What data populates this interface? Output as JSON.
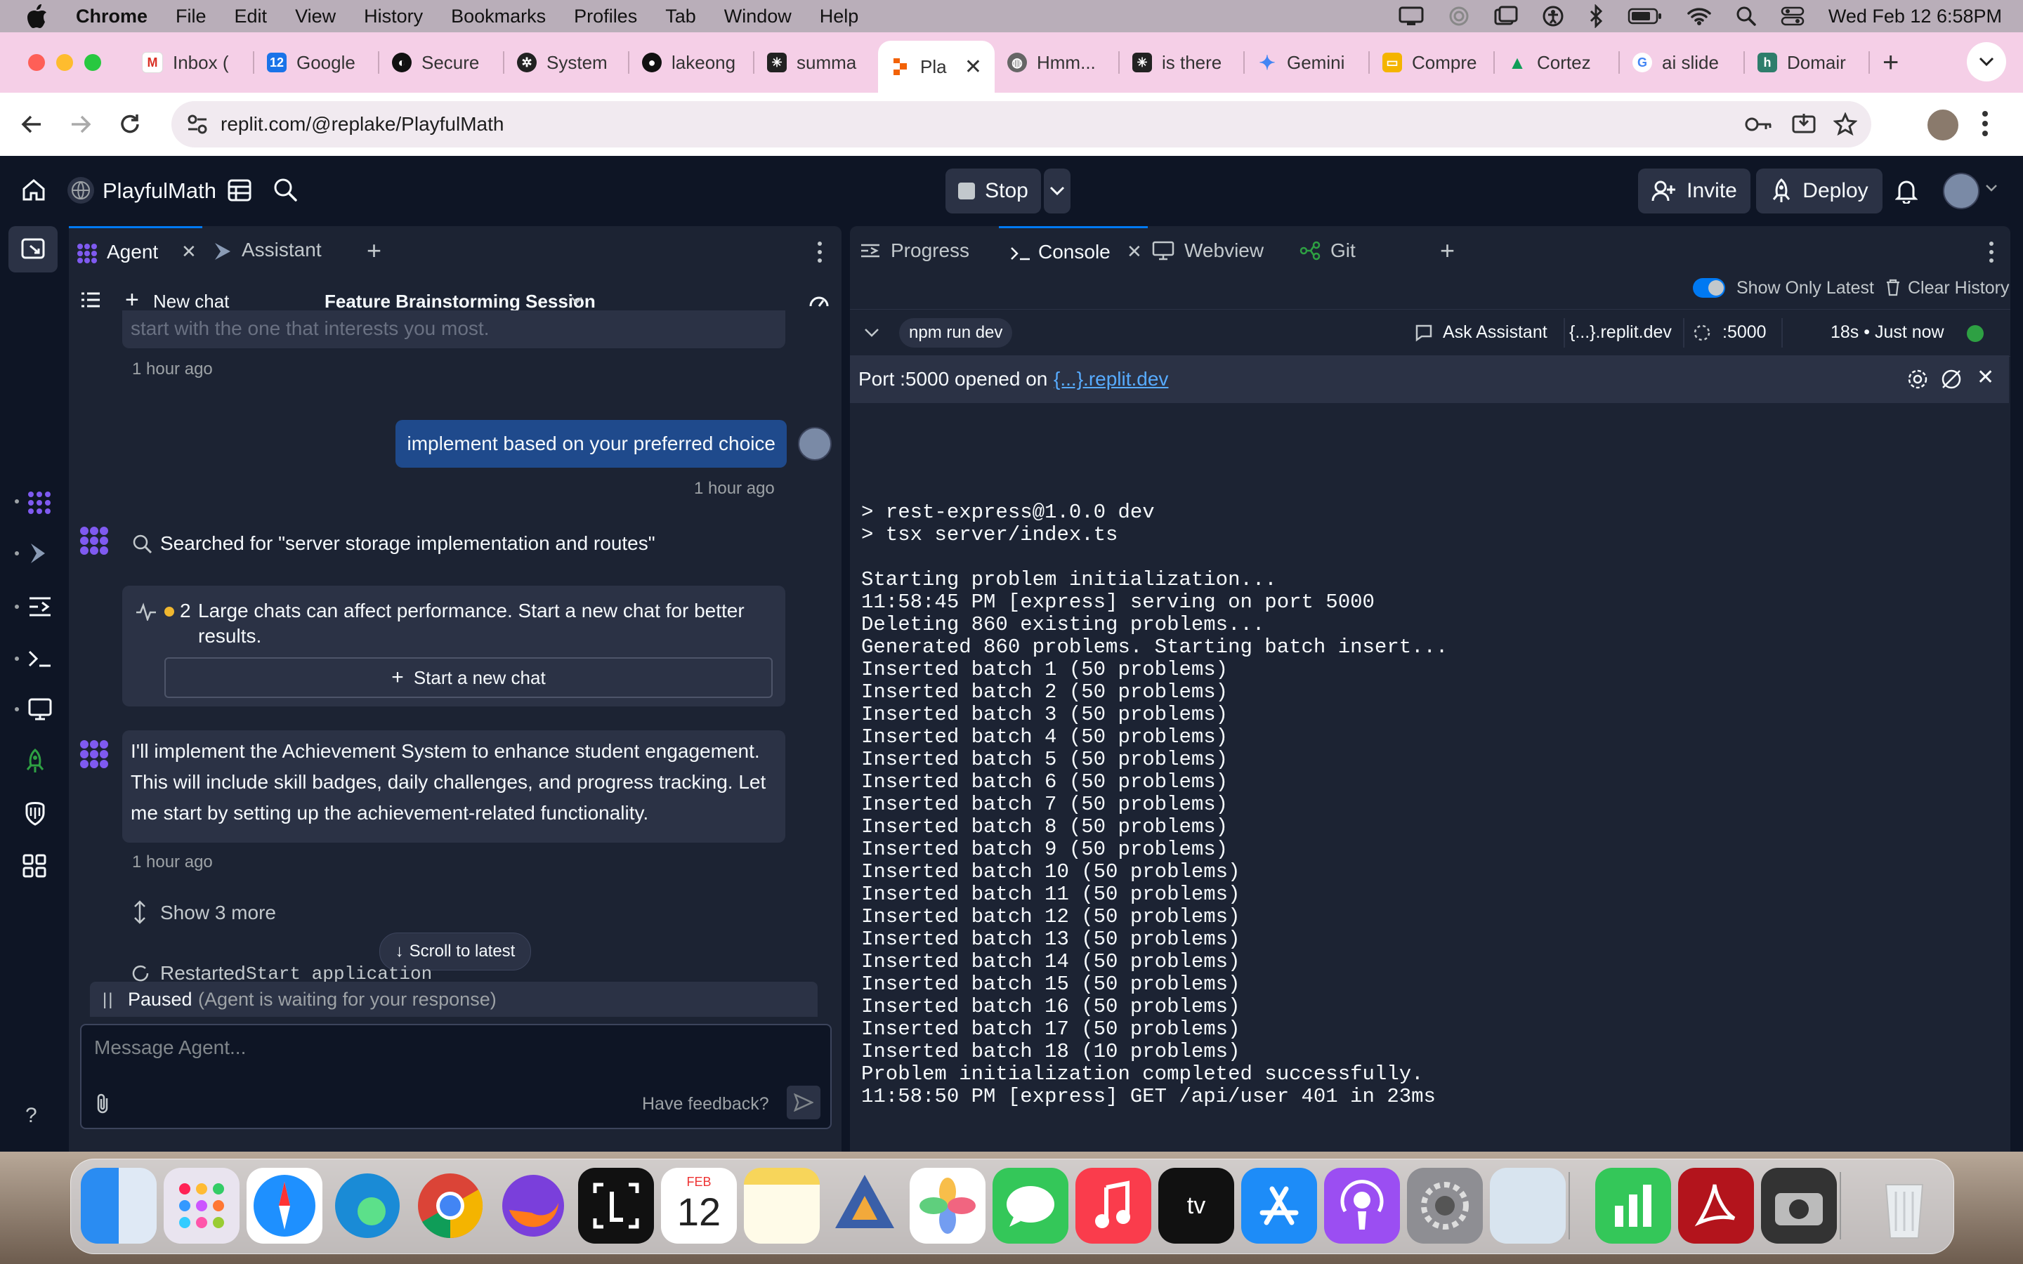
{
  "menubar": {
    "app_name": "Chrome",
    "menus": [
      "File",
      "Edit",
      "View",
      "History",
      "Bookmarks",
      "Profiles",
      "Tab",
      "Window",
      "Help"
    ],
    "clock": "Wed Feb 12  6:58PM"
  },
  "browser": {
    "tabs": [
      {
        "title": "Inbox (",
        "icon": "gmail-icon"
      },
      {
        "title": "Google",
        "icon": "google-calendar-icon"
      },
      {
        "title": "Secure",
        "icon": "secure-icon"
      },
      {
        "title": "System",
        "icon": "openai-icon"
      },
      {
        "title": "lakeong",
        "icon": "github-icon"
      },
      {
        "title": "summa",
        "icon": "perplexity-icon"
      },
      {
        "title": "Pla",
        "icon": "replit-icon",
        "active": true
      },
      {
        "title": "Hmm...",
        "icon": "globe-icon"
      },
      {
        "title": "is there",
        "icon": "perplexity-icon"
      },
      {
        "title": "Gemini",
        "icon": "gemini-icon"
      },
      {
        "title": "Compre",
        "icon": "slides-icon"
      },
      {
        "title": "Cortez",
        "icon": "drive-icon"
      },
      {
        "title": "ai slide",
        "icon": "google-icon"
      },
      {
        "title": "Domair",
        "icon": "hostinger-icon"
      }
    ],
    "url": "replit.com/@replake/PlayfulMath"
  },
  "replit": {
    "project_name": "PlayfulMath",
    "stop_label": "Stop",
    "invite_label": "Invite",
    "deploy_label": "Deploy",
    "left_tabs": {
      "agent": "Agent",
      "assistant": "Assistant"
    },
    "new_chat_label": "New chat",
    "session_title": "Feature Brainstorming Session",
    "faded_text": "start with the one that interests you most.",
    "time_1": "1 hour ago",
    "user_message": "implement based on your preferred choice",
    "time_2": "1 hour ago",
    "search_text": "Searched for \"server storage implementation and routes\"",
    "warning_count": "2",
    "warning_text_1": "Large chats can affect performance. Start a new chat for better",
    "warning_text_2": "results.",
    "start_new_chat_label": "Start a new chat",
    "agent_message_1": "I'll implement the Achievement System to enhance student engagement.",
    "agent_message_2": "This will include skill badges, daily challenges, and progress tracking. Let",
    "agent_message_3": "me start by setting up the achievement-related functionality.",
    "time_3": "1 hour ago",
    "show_more_label": "Show 3 more",
    "scroll_latest_label": "Scroll to latest",
    "restarted_label": "Restarted",
    "restarted_code": "Start application",
    "paused_label": "Paused",
    "paused_detail": "(Agent is waiting for your response)",
    "message_placeholder": "Message Agent...",
    "feedback_label": "Have feedback?",
    "right_tabs": {
      "progress": "Progress",
      "console": "Console",
      "webview": "Webview",
      "git": "Git"
    },
    "show_only_latest_label": "Show Only Latest",
    "show_only_latest_on": true,
    "clear_history_label": "Clear History",
    "command": "npm run dev",
    "ask_assistant_label": "Ask Assistant",
    "domain_label": "{...}.replit.dev",
    "port_label": ":5000",
    "run_time": "18s • Just now",
    "port_notice_prefix": "Port :5000 opened on ",
    "port_notice_link": "{...}.replit.dev",
    "console_lines": [
      "> rest-express@1.0.0 dev",
      "> tsx server/index.ts",
      "",
      "Starting problem initialization...",
      "11:58:45 PM [express] serving on port 5000",
      "Deleting 860 existing problems...",
      "Generated 860 problems. Starting batch insert...",
      "Inserted batch 1 (50 problems)",
      "Inserted batch 2 (50 problems)",
      "Inserted batch 3 (50 problems)",
      "Inserted batch 4 (50 problems)",
      "Inserted batch 5 (50 problems)",
      "Inserted batch 6 (50 problems)",
      "Inserted batch 7 (50 problems)",
      "Inserted batch 8 (50 problems)",
      "Inserted batch 9 (50 problems)",
      "Inserted batch 10 (50 problems)",
      "Inserted batch 11 (50 problems)",
      "Inserted batch 12 (50 problems)",
      "Inserted batch 13 (50 problems)",
      "Inserted batch 14 (50 problems)",
      "Inserted batch 15 (50 problems)",
      "Inserted batch 16 (50 problems)",
      "Inserted batch 17 (50 problems)",
      "Inserted batch 18 (10 problems)",
      "Problem initialization completed successfully.",
      "11:58:50 PM [express] GET /api/user 401 in 23ms"
    ]
  },
  "dock": {
    "calendar_month": "FEB",
    "calendar_day": "12"
  },
  "colors": {
    "replit_bg": "#0e1525",
    "panel_bg": "#1c2333",
    "accent_blue": "#0079f2",
    "agent_purple": "#7f5af0",
    "status_green": "#2ea043"
  }
}
